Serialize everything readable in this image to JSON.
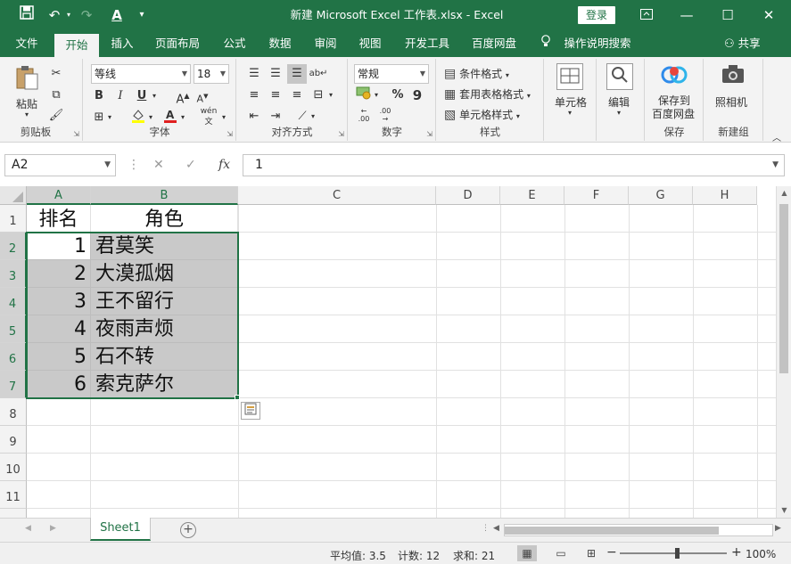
{
  "titlebar": {
    "title": "新建 Microsoft Excel 工作表.xlsx  -  Excel",
    "login": "登录",
    "save_icon": "save-icon",
    "undo_icon": "undo-icon",
    "redo_icon": "redo-icon",
    "font_color_icon": "font-color-icon"
  },
  "menu": {
    "tabs": [
      "文件",
      "开始",
      "插入",
      "页面布局",
      "公式",
      "数据",
      "审阅",
      "视图",
      "开发工具",
      "百度网盘"
    ],
    "active": "开始",
    "tell_me": "操作说明搜索",
    "share": "共享"
  },
  "ribbon": {
    "clipboard": {
      "label": "剪贴板",
      "paste": "粘贴"
    },
    "font": {
      "label": "字体",
      "font_name": "等线",
      "font_size": "18",
      "bold": "B",
      "italic": "I",
      "underline": "U",
      "grow": "A",
      "shrink": "A",
      "font_color_letter": "A",
      "phonetic": "wén"
    },
    "alignment": {
      "label": "对齐方式"
    },
    "number": {
      "label": "数字",
      "format": "常规",
      "percent": "%",
      "comma": "9",
      "inc_dec": ".00",
      "dec_dec": ".00"
    },
    "styles": {
      "label": "样式",
      "conditional": "条件格式",
      "table": "套用表格格式",
      "cell_styles": "单元格样式"
    },
    "cells": {
      "label": "",
      "cells": "单元格"
    },
    "editing": {
      "edit": "编辑"
    },
    "save_group": {
      "label": "保存",
      "save_to_baidu_l1": "保存到",
      "save_to_baidu_l2": "百度网盘"
    },
    "new_group": {
      "label": "新建组",
      "camera": "照相机"
    }
  },
  "formula_bar": {
    "name_box": "A2",
    "cancel": "✕",
    "enter": "✓",
    "fx": "fx",
    "value": "1"
  },
  "columns": [
    "A",
    "B",
    "C",
    "D",
    "E",
    "F",
    "G",
    "H"
  ],
  "rows": [
    "1",
    "2",
    "3",
    "4",
    "5",
    "6",
    "7",
    "8",
    "9",
    "10",
    "11"
  ],
  "cells": {
    "A1": "排名",
    "B1": "角色",
    "A2": "1",
    "B2": "君莫笑",
    "A3": "2",
    "B3": "大漠孤烟",
    "A4": "3",
    "B4": "王不留行",
    "A5": "4",
    "B5": "夜雨声烦",
    "A6": "5",
    "B6": "石不转",
    "A7": "6",
    "B7": "索克萨尔"
  },
  "sheets": {
    "active": "Sheet1",
    "add": "+"
  },
  "status": {
    "average": "平均值: 3.5",
    "count": "计数: 12",
    "sum": "求和: 21",
    "zoom": "100%",
    "minus": "−",
    "plus": "+"
  }
}
